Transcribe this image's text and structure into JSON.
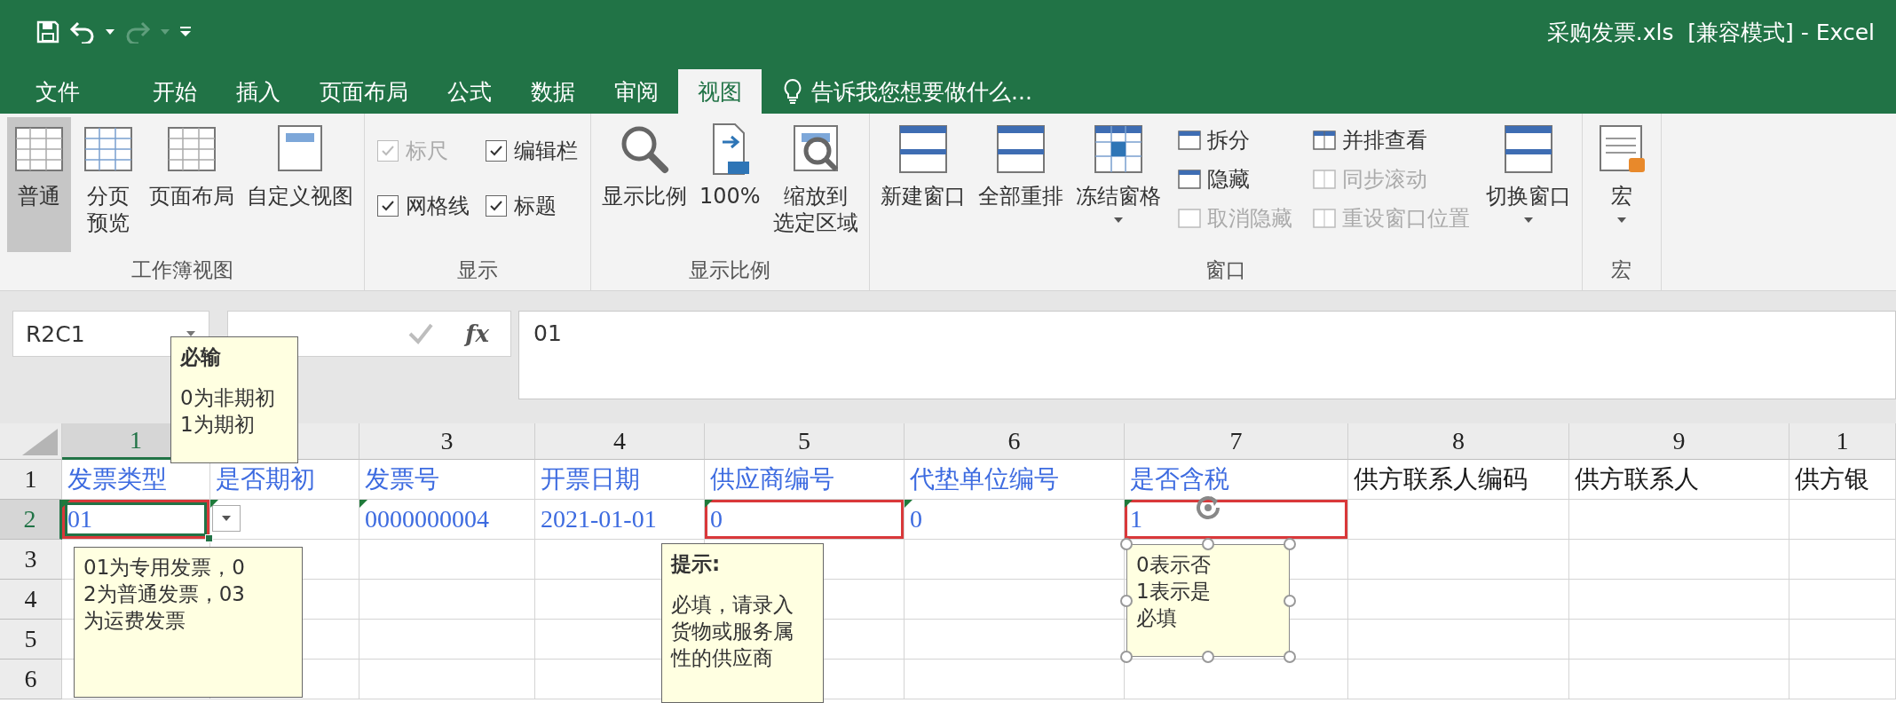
{
  "window": {
    "title": "采购发票.xls  [兼容模式] - Excel"
  },
  "ribbon_tabs": [
    {
      "label": "文件",
      "selected": false
    },
    {
      "label": "开始",
      "selected": false
    },
    {
      "label": "插入",
      "selected": false
    },
    {
      "label": "页面布局",
      "selected": false
    },
    {
      "label": "公式",
      "selected": false
    },
    {
      "label": "数据",
      "selected": false
    },
    {
      "label": "审阅",
      "selected": false
    },
    {
      "label": "视图",
      "selected": true
    }
  ],
  "tell_me": {
    "placeholder": "告诉我您想要做什么..."
  },
  "ribbon_groups": [
    {
      "label": "工作簿视图",
      "columns": [
        {
          "kind": "large",
          "lines": [
            "普通"
          ],
          "selected": true
        },
        {
          "kind": "large",
          "lines": [
            "分页",
            "预览"
          ],
          "selected": false
        },
        {
          "kind": "large",
          "lines": [
            "页面布局"
          ],
          "selected": false
        },
        {
          "kind": "large",
          "lines": [
            "自定义视图"
          ],
          "selected": false
        }
      ]
    },
    {
      "label": "显示",
      "columns": [
        {
          "kind": "stack",
          "items": [
            {
              "kind": "check",
              "label": "标尺",
              "checked": true,
              "disabled": true
            },
            {
              "kind": "check",
              "label": "网格线",
              "checked": true,
              "disabled": false
            }
          ]
        },
        {
          "kind": "stack",
          "items": [
            {
              "kind": "check",
              "label": "编辑栏",
              "checked": true,
              "disabled": false
            },
            {
              "kind": "check",
              "label": "标题",
              "checked": true,
              "disabled": false
            }
          ]
        }
      ]
    },
    {
      "label": "显示比例",
      "columns": [
        {
          "kind": "large",
          "lines": [
            "显示比例"
          ]
        },
        {
          "kind": "large",
          "lines": [
            "100%"
          ]
        },
        {
          "kind": "large",
          "lines": [
            "缩放到",
            "选定区域"
          ]
        }
      ]
    },
    {
      "label": "窗口",
      "columns": [
        {
          "kind": "large",
          "lines": [
            "新建窗口"
          ]
        },
        {
          "kind": "large",
          "lines": [
            "全部重排"
          ]
        },
        {
          "kind": "large",
          "lines": [
            "冻结窗格"
          ],
          "dropdown": true
        },
        {
          "kind": "stack",
          "items": [
            {
              "kind": "small",
              "label": "拆分",
              "disabled": false
            },
            {
              "kind": "small",
              "label": "隐藏",
              "disabled": false
            },
            {
              "kind": "small",
              "label": "取消隐藏",
              "disabled": true
            }
          ]
        },
        {
          "kind": "stack",
          "items": [
            {
              "kind": "small",
              "label": "并排查看",
              "disabled": false
            },
            {
              "kind": "small",
              "label": "同步滚动",
              "disabled": true
            },
            {
              "kind": "small",
              "label": "重设窗口位置",
              "disabled": true
            }
          ]
        },
        {
          "kind": "large",
          "lines": [
            "切换窗口"
          ],
          "dropdown": true
        }
      ]
    },
    {
      "label": "宏",
      "columns": [
        {
          "kind": "large",
          "lines": [
            "宏"
          ],
          "dropdown": true
        }
      ]
    }
  ],
  "name_box": {
    "value": "R2C1"
  },
  "formula_bar": {
    "function_label": "fx",
    "value": "01"
  },
  "sheet": {
    "columns": [
      {
        "label": "1",
        "selected": true
      },
      {
        "selected": false
      },
      {
        "label": "3",
        "selected": false
      },
      {
        "label": "4",
        "selected": false
      },
      {
        "label": "5",
        "selected": false
      },
      {
        "label": "6",
        "selected": false
      },
      {
        "label": "7",
        "selected": false
      },
      {
        "label": "8",
        "selected": false
      },
      {
        "label": "9",
        "selected": false
      },
      {
        "label": "1",
        "selected": false
      }
    ],
    "rows": [
      {
        "label": "1",
        "selected": false,
        "cells": [
          {
            "text": "发票类型",
            "color": "#3d6be0"
          },
          {
            "text": "是否期初",
            "color": "#3d6be0"
          },
          {
            "text": "发票号",
            "color": "#3d6be0"
          },
          {
            "text": "开票日期",
            "color": "#3d6be0"
          },
          {
            "text": "供应商编号",
            "color": "#3d6be0"
          },
          {
            "text": "代垫单位编号",
            "color": "#3d6be0"
          },
          {
            "text": "是否含税",
            "color": "#3d6be0"
          },
          {
            "text": "供方联系人编码",
            "color": "#1a1a1a"
          },
          {
            "text": "供方联系人",
            "color": "#1a1a1a"
          },
          {
            "text": "供方银",
            "color": "#1a1a1a"
          }
        ]
      },
      {
        "label": "2",
        "selected": true,
        "cells": [
          {
            "text": "01",
            "color": "#3d6be0",
            "flag": true,
            "highlighted": true,
            "selected": true
          },
          {
            "flag": true
          },
          {
            "text": "0000000004",
            "color": "#3d6be0",
            "flag": true
          },
          {
            "text": "2021-01-01",
            "color": "#3d6be0"
          },
          {
            "text": "0",
            "color": "#3d6be0",
            "flag": true,
            "highlighted": true
          },
          {
            "text": "0",
            "color": "#3d6be0",
            "flag": true
          },
          {
            "text": "1",
            "color": "#3d6be0",
            "flag": true,
            "highlighted": true
          },
          null,
          null,
          null
        ]
      },
      {
        "label": "3",
        "selected": false
      },
      {
        "label": "4",
        "selected": false
      },
      {
        "label": "5",
        "selected": false
      },
      {
        "label": "6",
        "selected": false
      }
    ]
  },
  "comments": [
    {
      "title": "必输",
      "lines": [
        "0为非期初",
        "1为期初"
      ],
      "selected": false
    },
    {
      "lines": [
        "01为专用发票，0",
        "2为普通发票，03",
        "为运费发票"
      ],
      "selected": false
    },
    {
      "title": "提示:",
      "lines": [
        "必填，请录入",
        "货物或服务属",
        "性的供应商"
      ],
      "selected": false
    },
    {
      "lines": [
        "0表示否",
        "1表示是",
        "必填"
      ],
      "selected": true
    }
  ]
}
